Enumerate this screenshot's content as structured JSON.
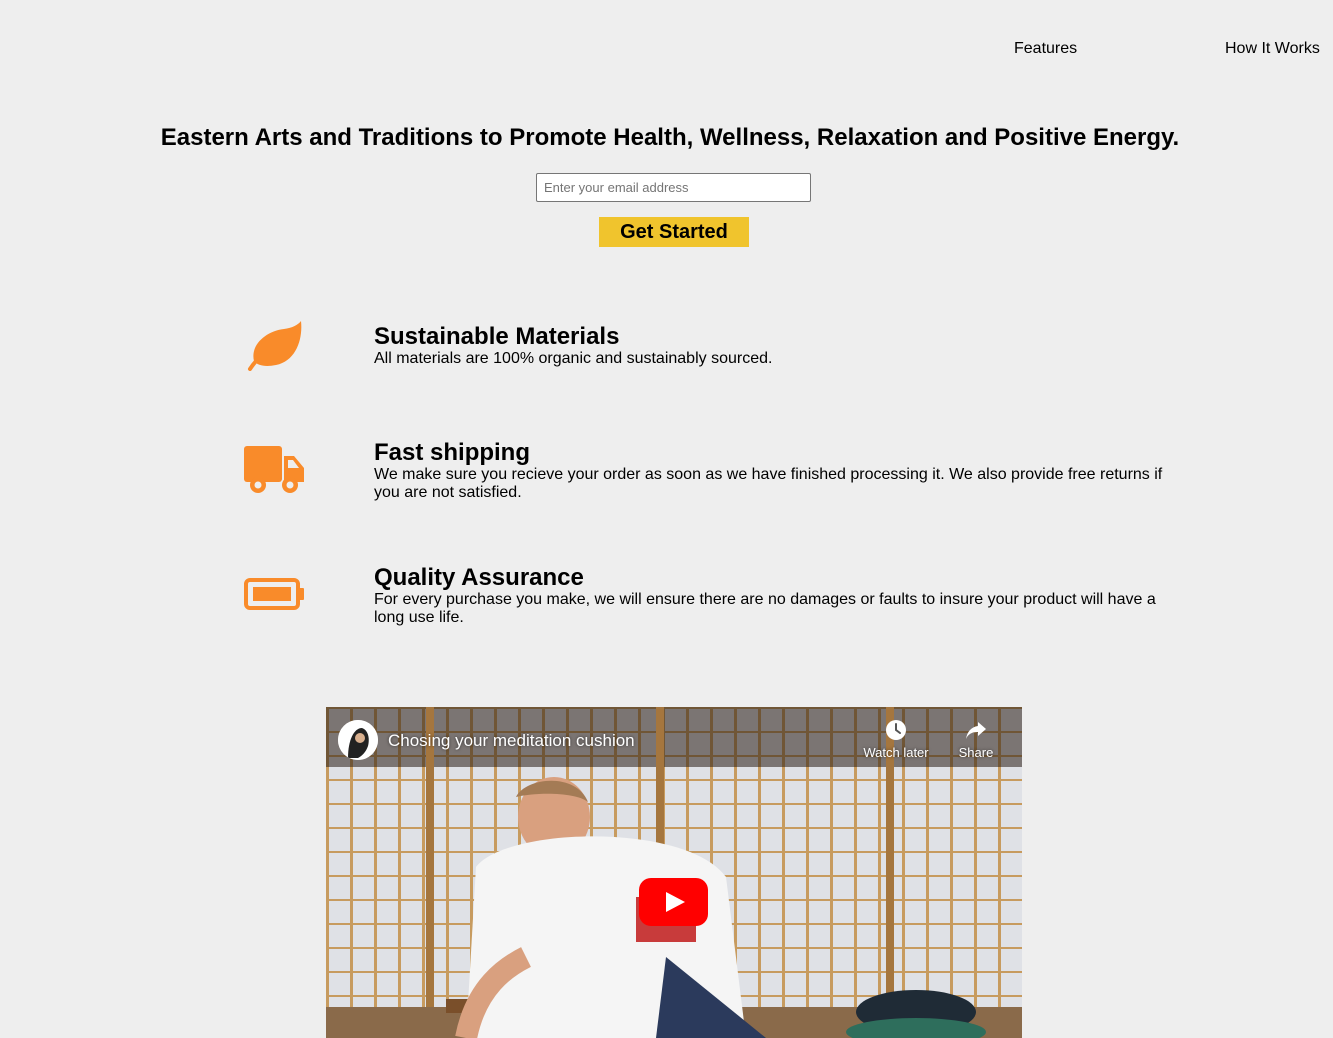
{
  "nav": {
    "links": [
      {
        "label": "Features"
      },
      {
        "label": "How It Works"
      }
    ]
  },
  "hero": {
    "title": "Eastern Arts and Traditions to Promote Health, Wellness, Relaxation and Positive Energy.",
    "email_placeholder": "Enter your email address",
    "email_value": "",
    "cta_label": "Get Started"
  },
  "features": [
    {
      "icon": "leaf-icon",
      "title": "Sustainable Materials",
      "description": "All materials are 100% organic and sustainably sourced."
    },
    {
      "icon": "truck-icon",
      "title": "Fast shipping",
      "description": "We make sure you recieve your order as soon as we have finished processing it. We also provide free returns if you are not satisfied."
    },
    {
      "icon": "battery-full-icon",
      "title": "Quality Assurance",
      "description": "For every purchase you make, we will ensure there are no damages or faults to insure your product will have a long use life."
    }
  ],
  "video": {
    "title": "Chosing your meditation cushion",
    "watch_later_label": "Watch later",
    "share_label": "Share"
  },
  "colors": {
    "background": "#eeeeee",
    "accent_orange": "#f98b2a",
    "cta_yellow": "#f0c42d",
    "youtube_red": "#ff0000"
  }
}
